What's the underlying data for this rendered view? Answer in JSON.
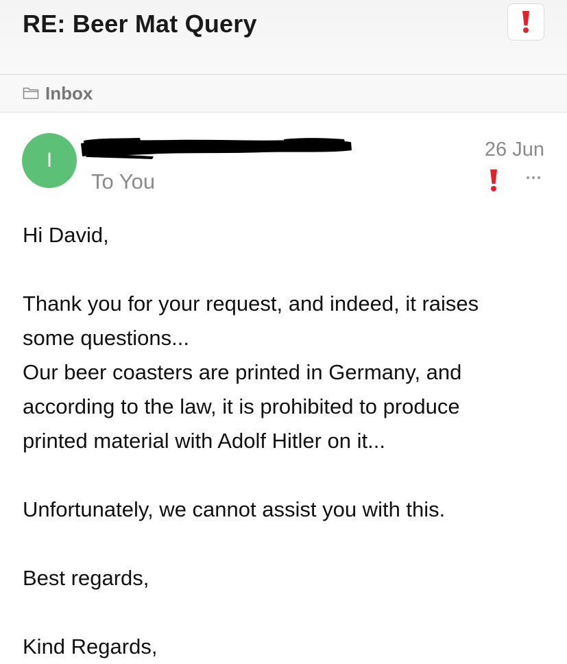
{
  "email": {
    "subject": "RE: Beer Mat Query",
    "folder": "Inbox",
    "avatar_initial": "I",
    "recipient": "To You",
    "date": "26 Jun",
    "body": {
      "greeting": "Hi David,",
      "p1_line1": "Thank you for your request, and indeed, it raises",
      "p1_line2": "some questions...",
      "p1_line3": "Our beer coasters are printed in Germany, and",
      "p1_line4": "according to the law, it is prohibited to produce",
      "p1_line5": "printed material with Adolf Hitler on it...",
      "p2": "Unfortunately, we cannot assist you with this.",
      "closing1": "Best regards,",
      "closing2": "Kind Regards,"
    }
  },
  "icons": {
    "flag": "exclamation-flag-icon",
    "folder": "folder-icon",
    "more": "more-icon"
  },
  "colors": {
    "flag_red": "#e5222c",
    "avatar_green": "#5cc076",
    "muted_gray": "#8a8a8a"
  }
}
